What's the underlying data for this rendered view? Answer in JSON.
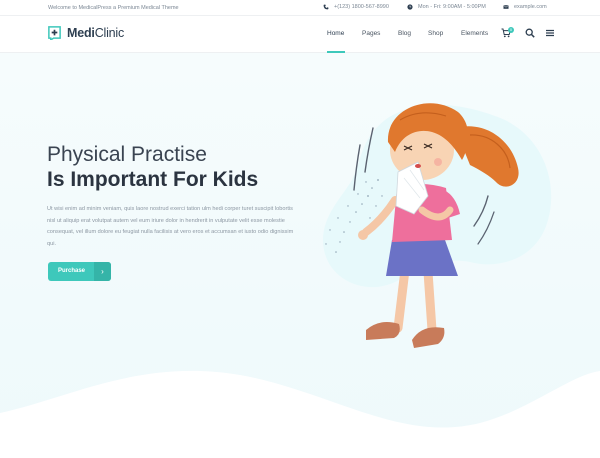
{
  "topbar": {
    "welcome": "Welcome to MedicalPress a Premium Medical Theme",
    "phone": "+(123) 1800-567-8990",
    "hours": "Mon - Fri: 9:00AM - 5:00PM",
    "email": "example.com"
  },
  "brand": {
    "name_bold": "Medi",
    "name_rest": "Clinic"
  },
  "nav": {
    "items": [
      "Home",
      "Pages",
      "Blog",
      "Shop",
      "Elements"
    ],
    "active": "Home",
    "cart_count": "0"
  },
  "hero": {
    "title_line1": "Physical Practise",
    "title_line2": "Is Important For Kids",
    "body": "Ut wisi enim ad minim veniam, quis laore nostrud exerci tation ulm hedi corper turet suscipit lobortis nisl ut aliquip erat volutpat autem vel eum iriure dolor in hendrerit in vulputate velit esse molestie consequat, vel illum dolore eu feugiat nulla facilisis at vero eros et accumsan et iusto odio dignissim qui.",
    "cta_label": "Purchase",
    "cta_icon": "chevron-right-icon"
  },
  "colors": {
    "accent": "#3ec8bb",
    "heading": "#2b3440",
    "body_text": "#8d98a3",
    "hero_bg": "#f2fbfc"
  }
}
